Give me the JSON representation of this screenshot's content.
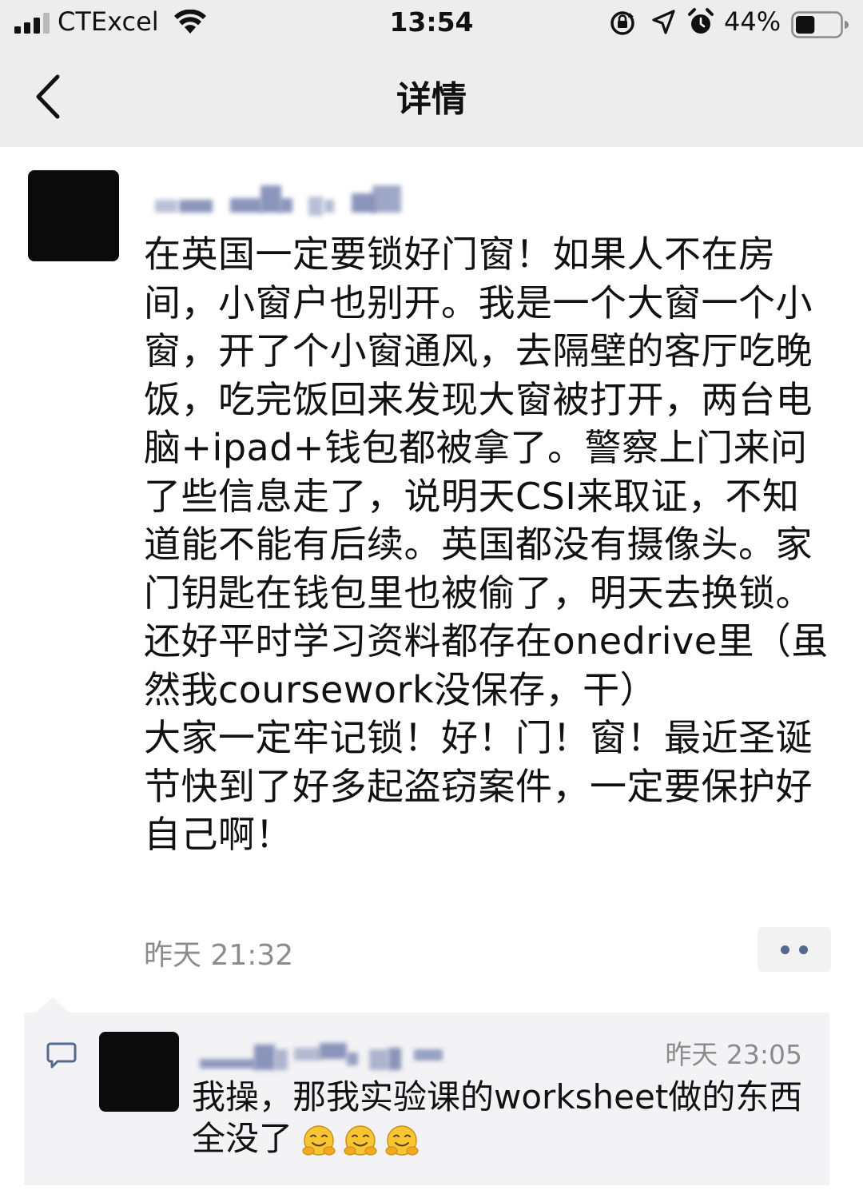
{
  "status_bar": {
    "carrier": "CTExcel",
    "time": "13:54",
    "battery": "44%",
    "battery_level": 0.44,
    "icons": [
      "signal-icon",
      "wifi-icon",
      "rotation-lock-icon",
      "location-icon",
      "alarm-icon",
      "battery-icon"
    ]
  },
  "nav": {
    "title": "详情",
    "back_icon": "chevron-left-icon"
  },
  "post": {
    "text": "在英国一定要锁好门窗！如果人不在房间，小窗户也别开。我是一个大窗一个小窗，开了个小窗通风，去隔壁的客厅吃晚饭，吃完饭回来发现大窗被打开，两台电脑+ipad+钱包都被拿了。警察上门来问了些信息走了，说明天CSI来取证，不知道能不能有后续。英国都没有摄像头。家门钥匙在钱包里也被偷了，明天去换锁。还好平时学习资料都存在onedrive里（虽然我coursework没保存，干）\n大家一定牢记锁！好！门！窗！最近圣诞节快到了好多起盗窃案件，一定要保护好自己啊！",
    "timestamp": "昨天 21:32",
    "more_icon": "more-dots-icon"
  },
  "comments": [
    {
      "time": "昨天 23:05",
      "text": "我操，那我实验课的worksheet做的东西全没了",
      "emoji": [
        "hug-emoji",
        "hug-emoji",
        "hug-emoji"
      ]
    }
  ],
  "colors": {
    "nav_bg": "#ededed",
    "comment_bg": "#f3f3f5",
    "link_blue": "#55698f",
    "meta_gray": "#8c8c8c"
  }
}
